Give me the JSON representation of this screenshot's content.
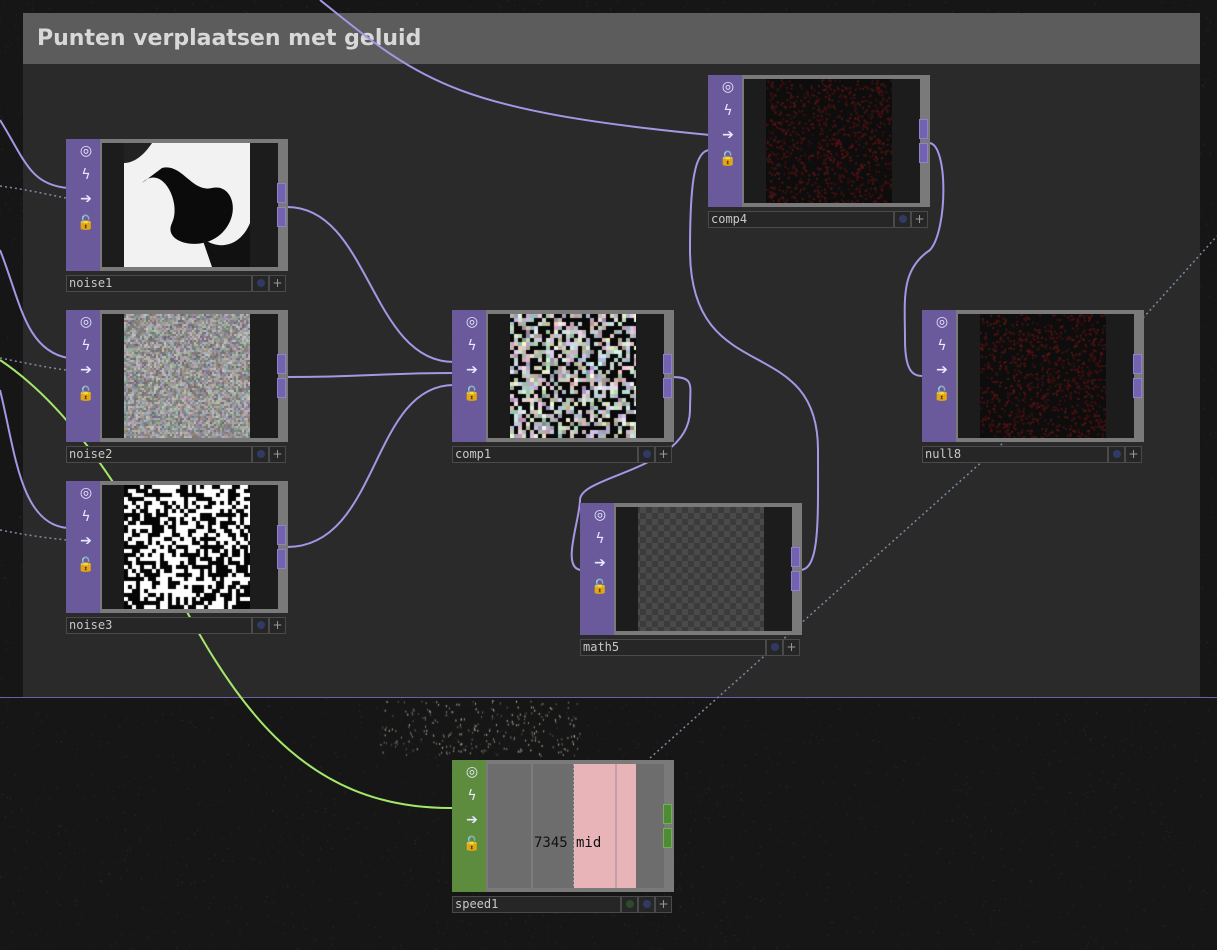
{
  "annotation": {
    "title": "Punten verplaatsen met geluid"
  },
  "operators": {
    "noise1": {
      "name": "noise1"
    },
    "noise2": {
      "name": "noise2"
    },
    "noise3": {
      "name": "noise3"
    },
    "comp1": {
      "name": "comp1"
    },
    "comp4": {
      "name": "comp4"
    },
    "math5": {
      "name": "math5"
    },
    "null8": {
      "name": "null8"
    },
    "speed1": {
      "name": "speed1",
      "value_text": "7345",
      "channel_text": "mid"
    }
  },
  "flags": {
    "viewer": "◎",
    "bypass": "ϟ",
    "display": "➔",
    "lock": "🔓"
  },
  "colors": {
    "top_family": "#6a5a9c",
    "chop_family": "#5d8c3e",
    "top_wire": "#a796e6",
    "chop_wire": "#a4e86a",
    "annotation_header": "#5c5c5c"
  }
}
